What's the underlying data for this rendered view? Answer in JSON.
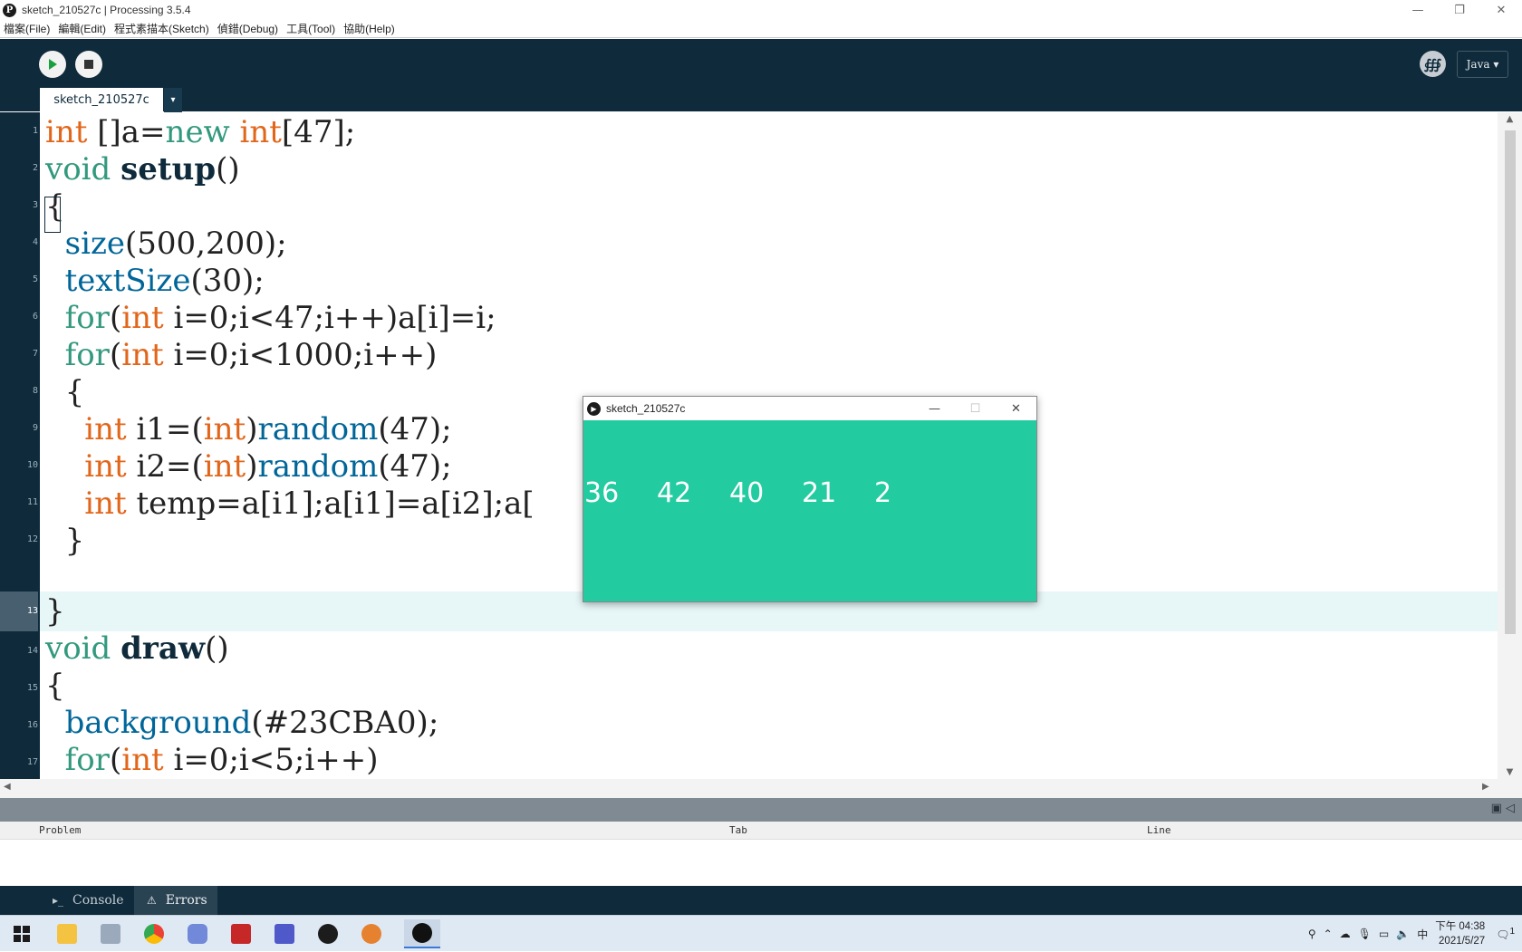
{
  "window": {
    "title": "sketch_210527c | Processing 3.5.4",
    "app_icon": "P",
    "controls": [
      "—",
      "❐",
      "✕"
    ]
  },
  "menu": [
    "檔案(File)",
    "編輯(Edit)",
    "程式素描本(Sketch)",
    "偵錯(Debug)",
    "工具(Tool)",
    "協助(Help)"
  ],
  "toolbar": {
    "mode": "Java ▾",
    "debug_glyph": "∰"
  },
  "tab": {
    "name": "sketch_210527c",
    "menu_arrow": "▾"
  },
  "line_numbers": [
    "1",
    "2",
    "3",
    "4",
    "5",
    "6",
    "7",
    "8",
    "9",
    "10",
    "11",
    "12",
    "13",
    "14",
    "15",
    "16",
    "17"
  ],
  "code": {
    "l1": [
      "int",
      " []a=",
      "new",
      " ",
      "int",
      "[47];"
    ],
    "l2": [
      "void",
      " ",
      "setup",
      "()"
    ],
    "l3": "{",
    "l4": [
      "  ",
      "size",
      "(500,200);"
    ],
    "l5": [
      "  ",
      "textSize",
      "(30);"
    ],
    "l6": [
      "  ",
      "for",
      "(",
      "int",
      " i=0;i<47;i++)a[i]=i;"
    ],
    "l7": [
      "  ",
      "for",
      "(",
      "int",
      " i=0;i<1000;i++)"
    ],
    "l8": "  {",
    "l9": [
      "    ",
      "int",
      " i1=(",
      "int",
      ")",
      "random",
      "(47);"
    ],
    "l10": [
      "    ",
      "int",
      " i2=(",
      "int",
      ")",
      "random",
      "(47);"
    ],
    "l11": [
      "    ",
      "int",
      " temp=a[i1];a[i1]=a[i2];a["
    ],
    "l12": "  }",
    "l13": "}",
    "l14": [
      "void",
      " ",
      "draw",
      "()"
    ],
    "l15": "{",
    "l16": [
      "  ",
      "background",
      "(#23CBA0);"
    ],
    "l17": [
      "  ",
      "for",
      "(",
      "int",
      " i=0;i<5;i++)"
    ]
  },
  "scroll_arrows": {
    "up": "▲",
    "down": "▼",
    "left": "◀",
    "right": "▶"
  },
  "error_panel": {
    "columns": [
      "Problem",
      "Tab",
      "Line"
    ],
    "panel_icons": "▣ ◁"
  },
  "footer_tabs": {
    "console": "Console",
    "console_icon": "▸_",
    "errors": "Errors",
    "errors_icon": "⚠"
  },
  "sketch_window": {
    "title": "sketch_210527c",
    "numbers": [
      "36",
      "42",
      "40",
      "21",
      "2"
    ],
    "background": "#23CBA0"
  },
  "taskbar": {
    "apps": [
      "start",
      "file-explorer",
      "photos",
      "chrome",
      "discord",
      "app-red",
      "teams",
      "processing",
      "app-orange",
      "sketch-run"
    ],
    "ime": "中",
    "time": "下午 04:38",
    "date": "2021/5/27",
    "notification_count": "1"
  },
  "colors": {
    "toolbar_bg": "#0e2a3b",
    "keyword": "#e2661a",
    "keyword_new": "#33997e",
    "function": "#006699"
  }
}
